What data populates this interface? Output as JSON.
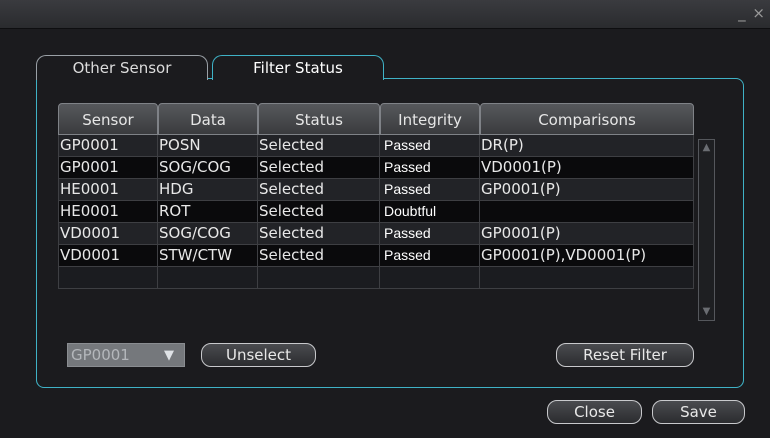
{
  "window": {
    "minimize": "_",
    "close": "×"
  },
  "tabs": [
    {
      "label": "Other Sensor",
      "active": false
    },
    {
      "label": "Filter Status",
      "active": true
    }
  ],
  "table": {
    "headers": [
      "Sensor",
      "Data",
      "Status",
      "Integrity",
      "Comparisons"
    ],
    "rows": [
      [
        "GP0001",
        "POSN",
        "Selected",
        "Passed",
        "DR(P)"
      ],
      [
        "GP0001",
        "SOG/COG",
        "Selected",
        "Passed",
        "VD0001(P)"
      ],
      [
        "HE0001",
        "HDG",
        "Selected",
        "Passed",
        "GP0001(P)"
      ],
      [
        "HE0001",
        "ROT",
        "Selected",
        "Doubtful",
        ""
      ],
      [
        "VD0001",
        "SOG/COG",
        "Selected",
        "Passed",
        "GP0001(P)"
      ],
      [
        "VD0001",
        "STW/CTW",
        "Selected",
        "Passed",
        "GP0001(P),VD0001(P)"
      ],
      [
        "",
        "",
        "",
        "",
        ""
      ]
    ]
  },
  "controls": {
    "sensor_select_value": "GP0001",
    "unselect_label": "Unselect",
    "reset_filter_label": "Reset Filter",
    "close_label": "Close",
    "save_label": "Save"
  },
  "colors": {
    "accent": "#3fb2c6",
    "background": "#1b1b1e"
  },
  "icons": {
    "minimize": "minimize-icon",
    "close": "close-icon",
    "dropdown": "chevron-down-icon",
    "scroll_up": "scroll-up-icon",
    "scroll_down": "scroll-down-icon"
  }
}
